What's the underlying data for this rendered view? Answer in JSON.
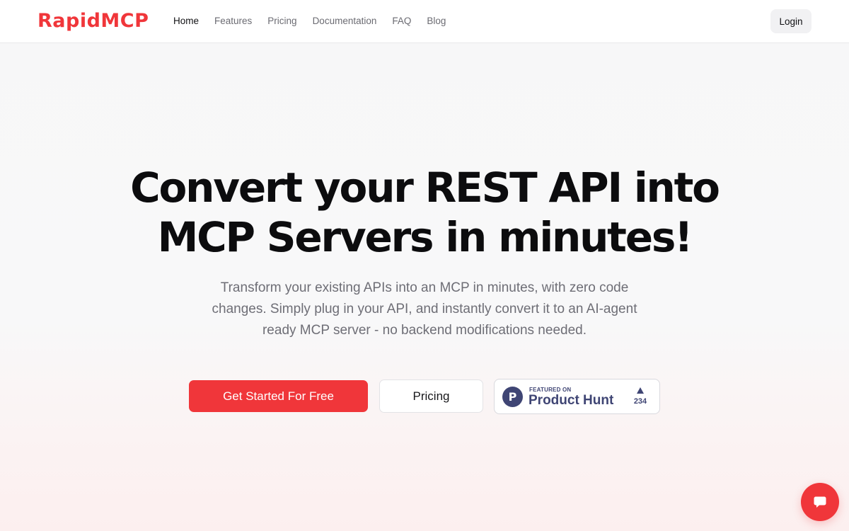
{
  "header": {
    "logo_text": "RapidMCP",
    "nav": [
      {
        "label": "Home",
        "active": true
      },
      {
        "label": "Features"
      },
      {
        "label": "Pricing"
      },
      {
        "label": "Documentation"
      },
      {
        "label": "FAQ"
      },
      {
        "label": "Blog"
      }
    ],
    "login_label": "Login"
  },
  "hero": {
    "title_line1": "Convert your REST API into",
    "title_line2": "MCP Servers in minutes!",
    "subtitle": "Transform your existing APIs into an MCP in minutes, with zero code changes. Simply plug in your API, and instantly convert it to an AI-agent ready MCP server - no backend modifications needed."
  },
  "cta": {
    "primary_label": "Get Started For Free",
    "secondary_label": "Pricing"
  },
  "product_hunt": {
    "logo_letter": "P",
    "featured_text": "FEATURED ON",
    "name": "Product Hunt",
    "upvotes": "234"
  },
  "chat": {
    "icon": "chat-bubble-icon"
  },
  "colors": {
    "brand_red": "#f0363a",
    "product_hunt": "#3f4574"
  }
}
